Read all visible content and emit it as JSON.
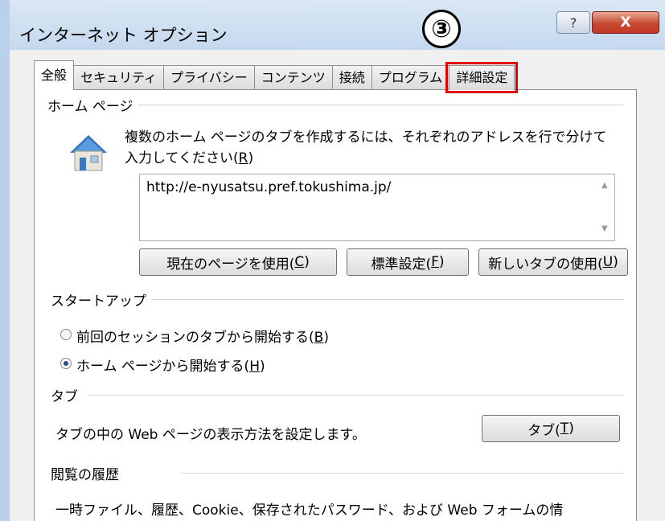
{
  "window": {
    "title": "インターネット オプション",
    "help_label": "?",
    "close_label": "X",
    "step_marker": "③"
  },
  "tabs": [
    {
      "label": "全般",
      "active": true
    },
    {
      "label": "セキュリティ"
    },
    {
      "label": "プライバシー"
    },
    {
      "label": "コンテンツ"
    },
    {
      "label": "接続"
    },
    {
      "label": "プログラム"
    },
    {
      "label": "詳細設定",
      "highlighted": true
    }
  ],
  "home_page": {
    "group_label": "ホーム ページ",
    "description_line1": "複数のホーム ページのタブを作成するには、それぞれのアドレスを行で分けて",
    "description_line2_prefix": "入力してください(",
    "description_line2_key": "R",
    "description_line2_suffix": ")",
    "url_value": "http://e-nyusatsu.pref.tokushima.jp/",
    "buttons": {
      "use_current": {
        "prefix": "現在のページを使用(",
        "key": "C",
        "suffix": ")"
      },
      "use_default": {
        "prefix": "標準設定(",
        "key": "F",
        "suffix": ")"
      },
      "use_new_tab": {
        "prefix": "新しいタブの使用(",
        "key": "U",
        "suffix": ")"
      }
    }
  },
  "startup": {
    "group_label": "スタートアップ",
    "option1": {
      "prefix": "前回のセッションのタブから開始する(",
      "key": "B",
      "suffix": ")",
      "checked": false
    },
    "option2": {
      "prefix": "ホーム ページから開始する(",
      "key": "H",
      "suffix": ")",
      "checked": true
    }
  },
  "tabs_section": {
    "group_label": "タブ",
    "description": "タブの中の Web ページの表示方法を設定します。",
    "button": {
      "prefix": "タブ(",
      "key": "T",
      "suffix": ")"
    }
  },
  "history": {
    "group_label": "閲覧の履歴",
    "description_line1": "一時ファイル、履歴、Cookie、保存されたパスワード、および Web フォームの情"
  },
  "colors": {
    "highlight_border": "#e00000",
    "close_button": "#c74a33"
  }
}
